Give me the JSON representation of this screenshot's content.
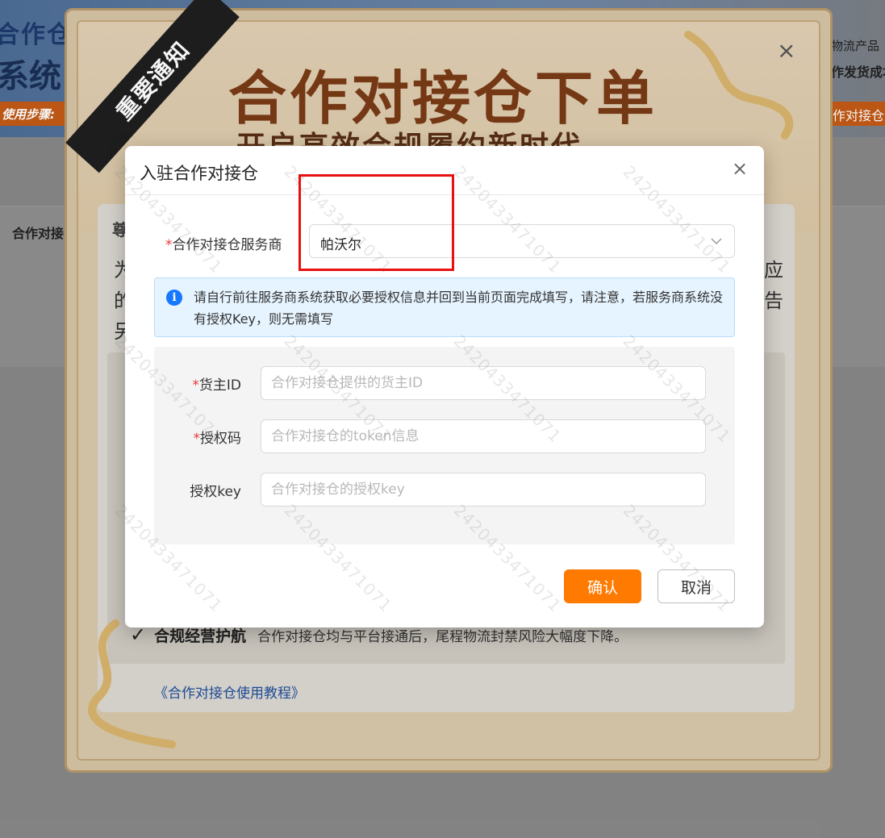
{
  "background": {
    "banner_title_line1": "合作仓",
    "banner_title_line2": "系统",
    "banner_steps": "使用步骤:",
    "right_text1": "物流产品",
    "right_text2": "作发货成本",
    "right_bar": "作对接仓",
    "tab": "合作对接"
  },
  "notice": {
    "ribbon": "重要通知",
    "title": "合作对接仓下单",
    "subtitle": "开启高效合规履约新时代",
    "close_icon": "×",
    "heading": "尊",
    "line1_start": "为",
    "line2_start": "的",
    "line3_start": "另",
    "line1_end": "应",
    "line2_end": "告",
    "check_icon": "✓",
    "check_title": "合规经营护航",
    "check_text": "合作对接仓均与平台接通后，尾程物流封禁风险大幅度下降。",
    "tutorial_link": "《合作对接仓使用教程》"
  },
  "modal": {
    "title": "入驻合作对接仓",
    "close_icon": "×",
    "provider": {
      "required_mark": "*",
      "label": "合作对接仓服务商",
      "value": "帕沃尔"
    },
    "info": {
      "icon": "i",
      "text": "请自行前往服务商系统获取必要授权信息并回到当前页面完成填写，请注意，若服务商系统没有授权Key，则无需填写"
    },
    "fields": [
      {
        "required_mark": "*",
        "label": "货主ID",
        "placeholder": "合作对接仓提供的货主ID",
        "value": ""
      },
      {
        "required_mark": "*",
        "label": "授权码",
        "placeholder": "合作对接仓的token信息",
        "value": ""
      },
      {
        "required_mark": "",
        "label": "授权key",
        "placeholder": "合作对接仓的授权key",
        "value": ""
      }
    ],
    "confirm_label": "确认",
    "cancel_label": "取消"
  },
  "watermark_text": "2420433471071",
  "colors": {
    "accent": "#ff7a00",
    "required": "#e4393c",
    "info_icon": "#1677ff",
    "highlight": "#e81010",
    "link": "#1f4f9c"
  }
}
